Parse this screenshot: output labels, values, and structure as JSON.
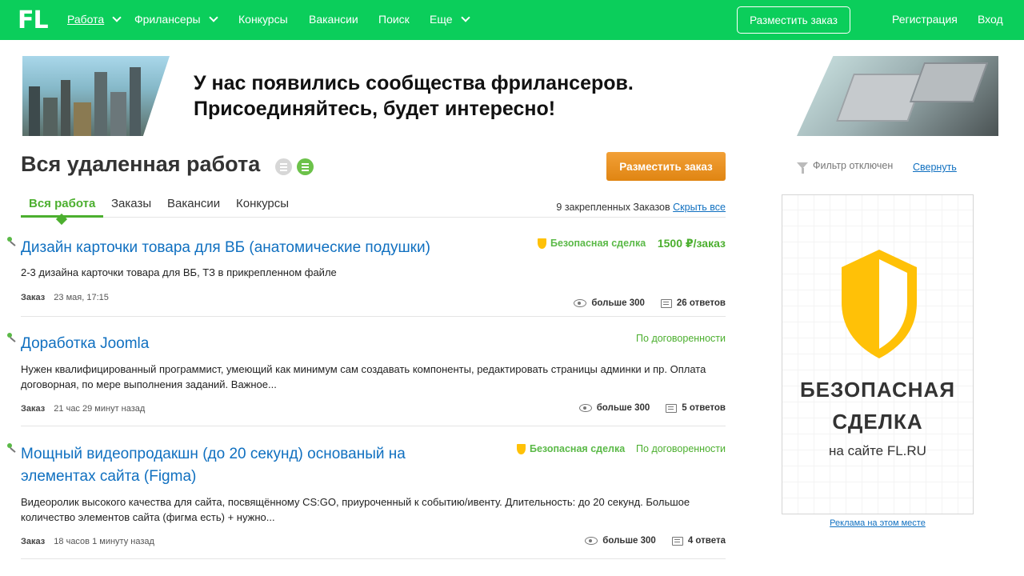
{
  "logo": "FL",
  "nav": {
    "items": [
      {
        "label": "Работа",
        "dropdown": true
      },
      {
        "label": "Фрилансеры",
        "dropdown": true
      },
      {
        "label": "Конкурсы",
        "dropdown": false
      },
      {
        "label": "Вакансии",
        "dropdown": false
      },
      {
        "label": "Поиск",
        "dropdown": false
      },
      {
        "label": "Еще",
        "dropdown": true
      }
    ],
    "place_order": "Разместить заказ",
    "register": "Регистрация",
    "login": "Вход"
  },
  "banner": {
    "line1": "У нас появились сообщества фрилансеров.",
    "line2": "Присоединяйтесь, будет интересно!"
  },
  "main": {
    "title": "Вся удаленная работа",
    "place_order_button": "Разместить заказ",
    "tabs": [
      {
        "label": "Вся работа",
        "active": true
      },
      {
        "label": "Заказы",
        "active": false
      },
      {
        "label": "Вакансии",
        "active": false
      },
      {
        "label": "Конкурсы",
        "active": false
      }
    ],
    "pinned_text": "9 закрепленных Заказов",
    "hide_all": "Скрыть все"
  },
  "projects": [
    {
      "title": "Дизайн карточки товара для ВБ (анатомические подушки)",
      "description": "2-3 дизайна карточки товара для ВБ, ТЗ в прикрепленном файле",
      "safe_deal": "Безопасная сделка",
      "price": "1500 ₽/заказ",
      "type": "Заказ",
      "time": "23 мая, 17:15",
      "views": "больше 300",
      "responses": "26 ответов"
    },
    {
      "title": "Доработка Joomla",
      "description": "Нужен квалифицированный программист, умеющий как минимум сам создавать компоненты, редактировать страницы админки и пр. Оплата договорная, по мере выполнения заданий. Важное...",
      "safe_deal": "",
      "price": "По договоренности",
      "type": "Заказ",
      "time": "21 час 29 минут назад",
      "views": "больше 300",
      "responses": "5 ответов"
    },
    {
      "title": "Мощный видеопродакшн (до 20 секунд) основаный на элементах сайта (Figma)",
      "description": "Видеоролик высокого качества для сайта, посвящённому CS:GO, приуроченный к событию/ивенту. Длительность: до 20 секунд. Большое количество элементов сайта (фигма есть) + нужно...",
      "safe_deal": "Безопасная сделка",
      "price": "По договоренности",
      "type": "Заказ",
      "time": "18 часов 1 минуту назад",
      "views": "больше 300",
      "responses": "4 ответа"
    }
  ],
  "sidebar": {
    "filter_status": "Фильтр отключен",
    "collapse": "Свернуть",
    "ad_title_line1": "БЕЗОПАСНАЯ",
    "ad_title_line2": "СДЕЛКА",
    "ad_subtitle": "на сайте FL.RU",
    "ad_link": "Реклама на этом месте"
  },
  "colors": {
    "brand_green": "#0bce5b",
    "link_blue": "#1070c0",
    "price_green": "#4caf2f",
    "order_button": "#e8911f",
    "shield_yellow": "#ffc107"
  }
}
